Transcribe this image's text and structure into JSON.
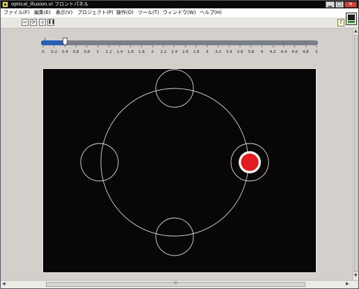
{
  "window": {
    "title": "optical_illusion.vi フロントパネル",
    "min_label": "▁",
    "max_label": "□",
    "close_label": "✕"
  },
  "menu": [
    "ファイル(F)",
    "編集(E)",
    "表示(V)",
    "プロジェクト(P)",
    "操作(O)",
    "ツール(T)",
    "ウィンドウ(W)",
    "ヘルプ(H)"
  ],
  "toolbar": {
    "run_icon": "run-arrow-icon",
    "run_continuous_icon": "run-continuously-icon",
    "abort_icon": "abort-stop-icon",
    "pause_icon": "pause-icon",
    "help_label": "?",
    "run_glyph": "⇨",
    "run_continuous_glyph": "⟳",
    "pause_glyph": "❚❚"
  },
  "slider": {
    "value": 0.4,
    "min": 0,
    "max": 5,
    "marker": "v",
    "ticks": [
      "0",
      "0.2",
      "0.4",
      "0.6",
      "0.8",
      "1",
      "1.2",
      "1.4",
      "1.6",
      "1.8",
      "2",
      "2.2",
      "2.4",
      "2.6",
      "2.8",
      "3",
      "3.2",
      "3.4",
      "3.6",
      "3.8",
      "4",
      "4.2",
      "4.4",
      "4.6",
      "4.8",
      "5"
    ],
    "fill_color": "#2c5fb8",
    "track_color": "#7b7f88"
  },
  "display": {
    "background": "#080606",
    "line_color": "#dcdcdc",
    "dot_color": "#e01b22",
    "ring_color": "#f0f0f0",
    "active_position": "right"
  },
  "scroll": {
    "grip": "III"
  }
}
